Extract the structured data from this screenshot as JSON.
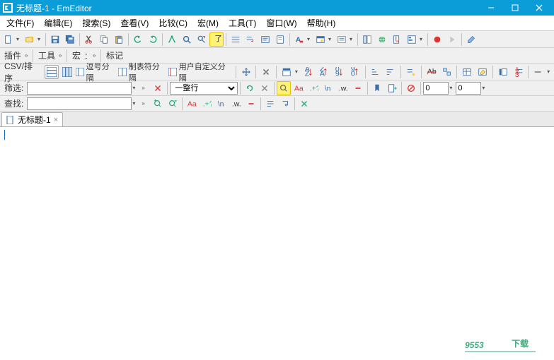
{
  "window": {
    "title": "无标题-1 - EmEditor"
  },
  "menu": {
    "file": "文件(F)",
    "edit": "编辑(E)",
    "search": "搜索(S)",
    "view": "查看(V)",
    "compare": "比较(C)",
    "macro": "宏(M)",
    "tools": "工具(T)",
    "window": "窗口(W)",
    "help": "帮助(H)"
  },
  "toolbar2": {
    "plugins": "插件",
    "tools": "工具",
    "macros": "宏",
    "marks": "标记"
  },
  "csvbar": {
    "label": "CSV/排序",
    "comma": "逗号分隔",
    "tab": "制表符分隔",
    "user": "用户自定义分隔",
    "col_default": "0",
    "row_default": "0"
  },
  "filterbar": {
    "label": "筛选:",
    "mode": "一整行"
  },
  "findbar": {
    "label": "查找:"
  },
  "tabs": {
    "doc1": "无标题-1"
  },
  "watermark": {
    "host": "9553",
    "suffix": "下载"
  }
}
